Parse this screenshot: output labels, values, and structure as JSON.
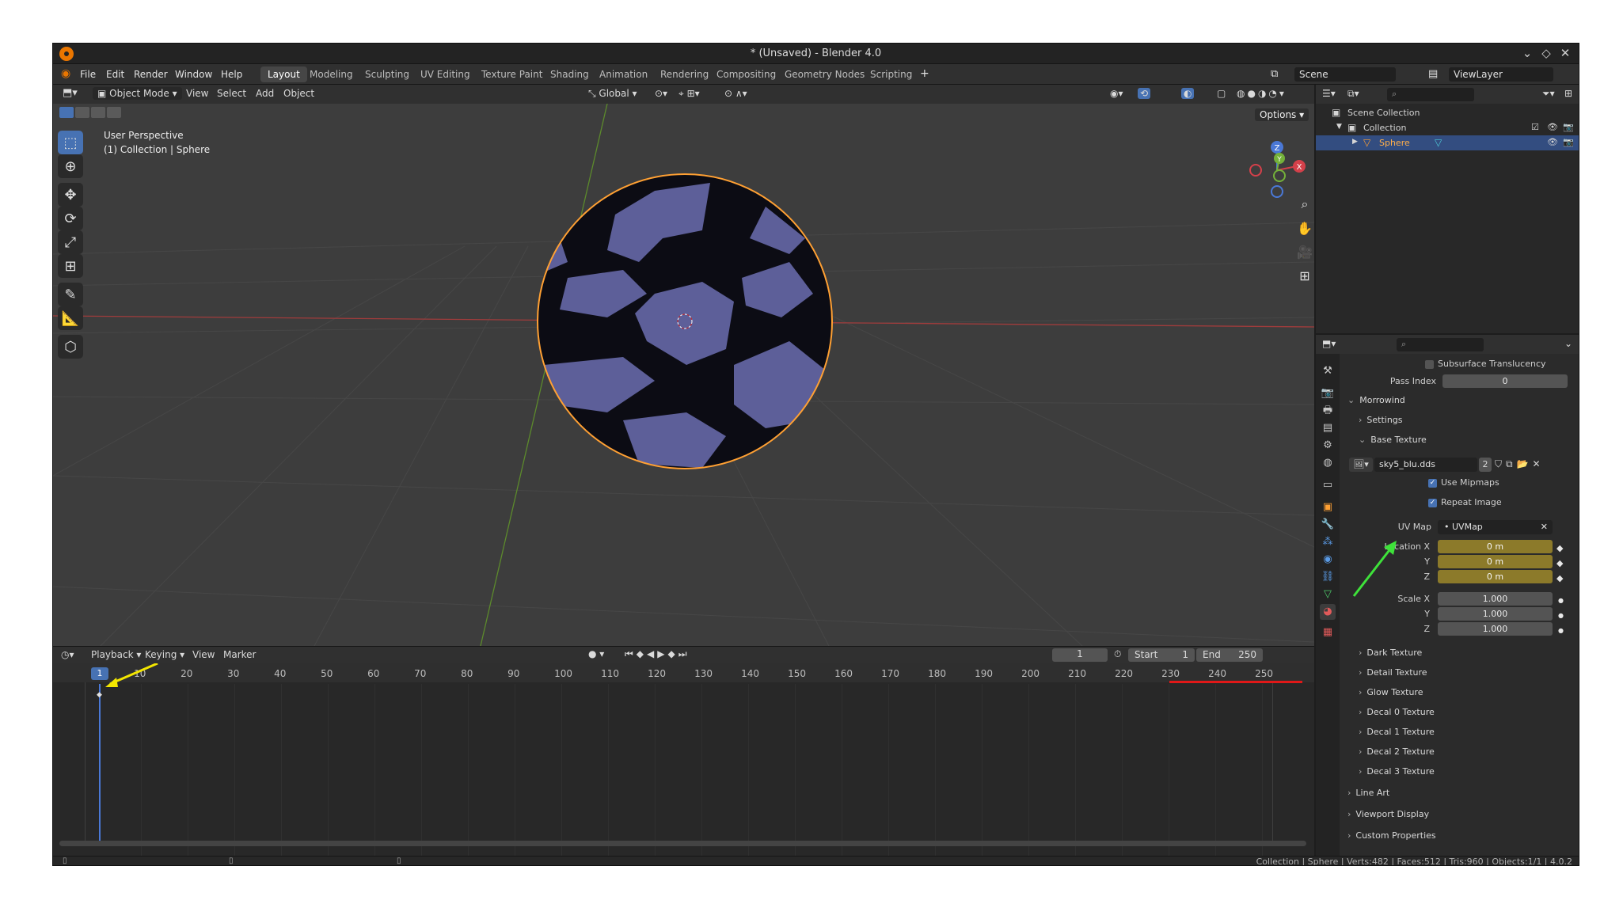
{
  "window": {
    "title": "* (Unsaved) - Blender 4.0"
  },
  "menu": [
    "File",
    "Edit",
    "Render",
    "Window",
    "Help"
  ],
  "workspaces": [
    "Layout",
    "Modeling",
    "Sculpting",
    "UV Editing",
    "Texture Paint",
    "Shading",
    "Animation",
    "Rendering",
    "Compositing",
    "Geometry Nodes",
    "Scripting"
  ],
  "active_workspace": "Layout",
  "scene": "Scene",
  "view_layer": "ViewLayer",
  "header3d": {
    "mode": "Object Mode",
    "view": "View",
    "select": "Select",
    "add": "Add",
    "object": "Object",
    "orientation": "Global",
    "options": "Options"
  },
  "viewport": {
    "perspective": "User Perspective",
    "collection_line": "(1) Collection | Sphere",
    "gizmo_x": "X",
    "gizmo_y": "Y",
    "gizmo_z": "Z"
  },
  "outliner": {
    "scene_collection": "Scene Collection",
    "collection": "Collection",
    "object": "Sphere"
  },
  "properties": {
    "subsurface": "Subsurface Translucency",
    "pass_index_label": "Pass Index",
    "pass_index_value": "0",
    "morrowind": "Morrowind",
    "settings": "Settings",
    "base_texture": "Base Texture",
    "image_name": "sky5_blu.dds",
    "image_users": "2",
    "use_mipmaps": "Use Mipmaps",
    "repeat_image": "Repeat Image",
    "uv_map_label": "UV Map",
    "uv_map_value": "UVMap",
    "location_label": "Location X",
    "y_label": "Y",
    "z_label": "Z",
    "location": [
      "0 m",
      "0 m",
      "0 m"
    ],
    "scale_label": "Scale X",
    "scale": [
      "1.000",
      "1.000",
      "1.000"
    ],
    "textures": [
      "Dark Texture",
      "Detail Texture",
      "Glow Texture",
      "Decal 0 Texture",
      "Decal 1 Texture",
      "Decal 2 Texture",
      "Decal 3 Texture"
    ],
    "line_art": "Line Art",
    "viewport_display": "Viewport Display",
    "custom_properties": "Custom Properties"
  },
  "timeline": {
    "playback": "Playback",
    "keying": "Keying",
    "view": "View",
    "marker": "Marker",
    "current_frame": "1",
    "start_label": "Start",
    "start": "1",
    "end_label": "End",
    "end": "250",
    "ticks": [
      "10",
      "20",
      "30",
      "40",
      "50",
      "60",
      "70",
      "80",
      "90",
      "100",
      "110",
      "120",
      "130",
      "140",
      "150",
      "160",
      "170",
      "180",
      "190",
      "200",
      "210",
      "220",
      "230",
      "240",
      "250"
    ],
    "playhead": "1"
  },
  "status": "Collection | Sphere | Verts:482 | Faces:512 | Tris:960 | Objects:1/1 | 4.0.2",
  "colors": {
    "accent": "#4772b3",
    "selection_outline": "#ffa033",
    "animated_field": "#8c7a2a",
    "annotation_arrow_yellow": "#f3e600",
    "annotation_arrow_green": "#3ee23a",
    "annotation_line_red": "#e01818"
  }
}
